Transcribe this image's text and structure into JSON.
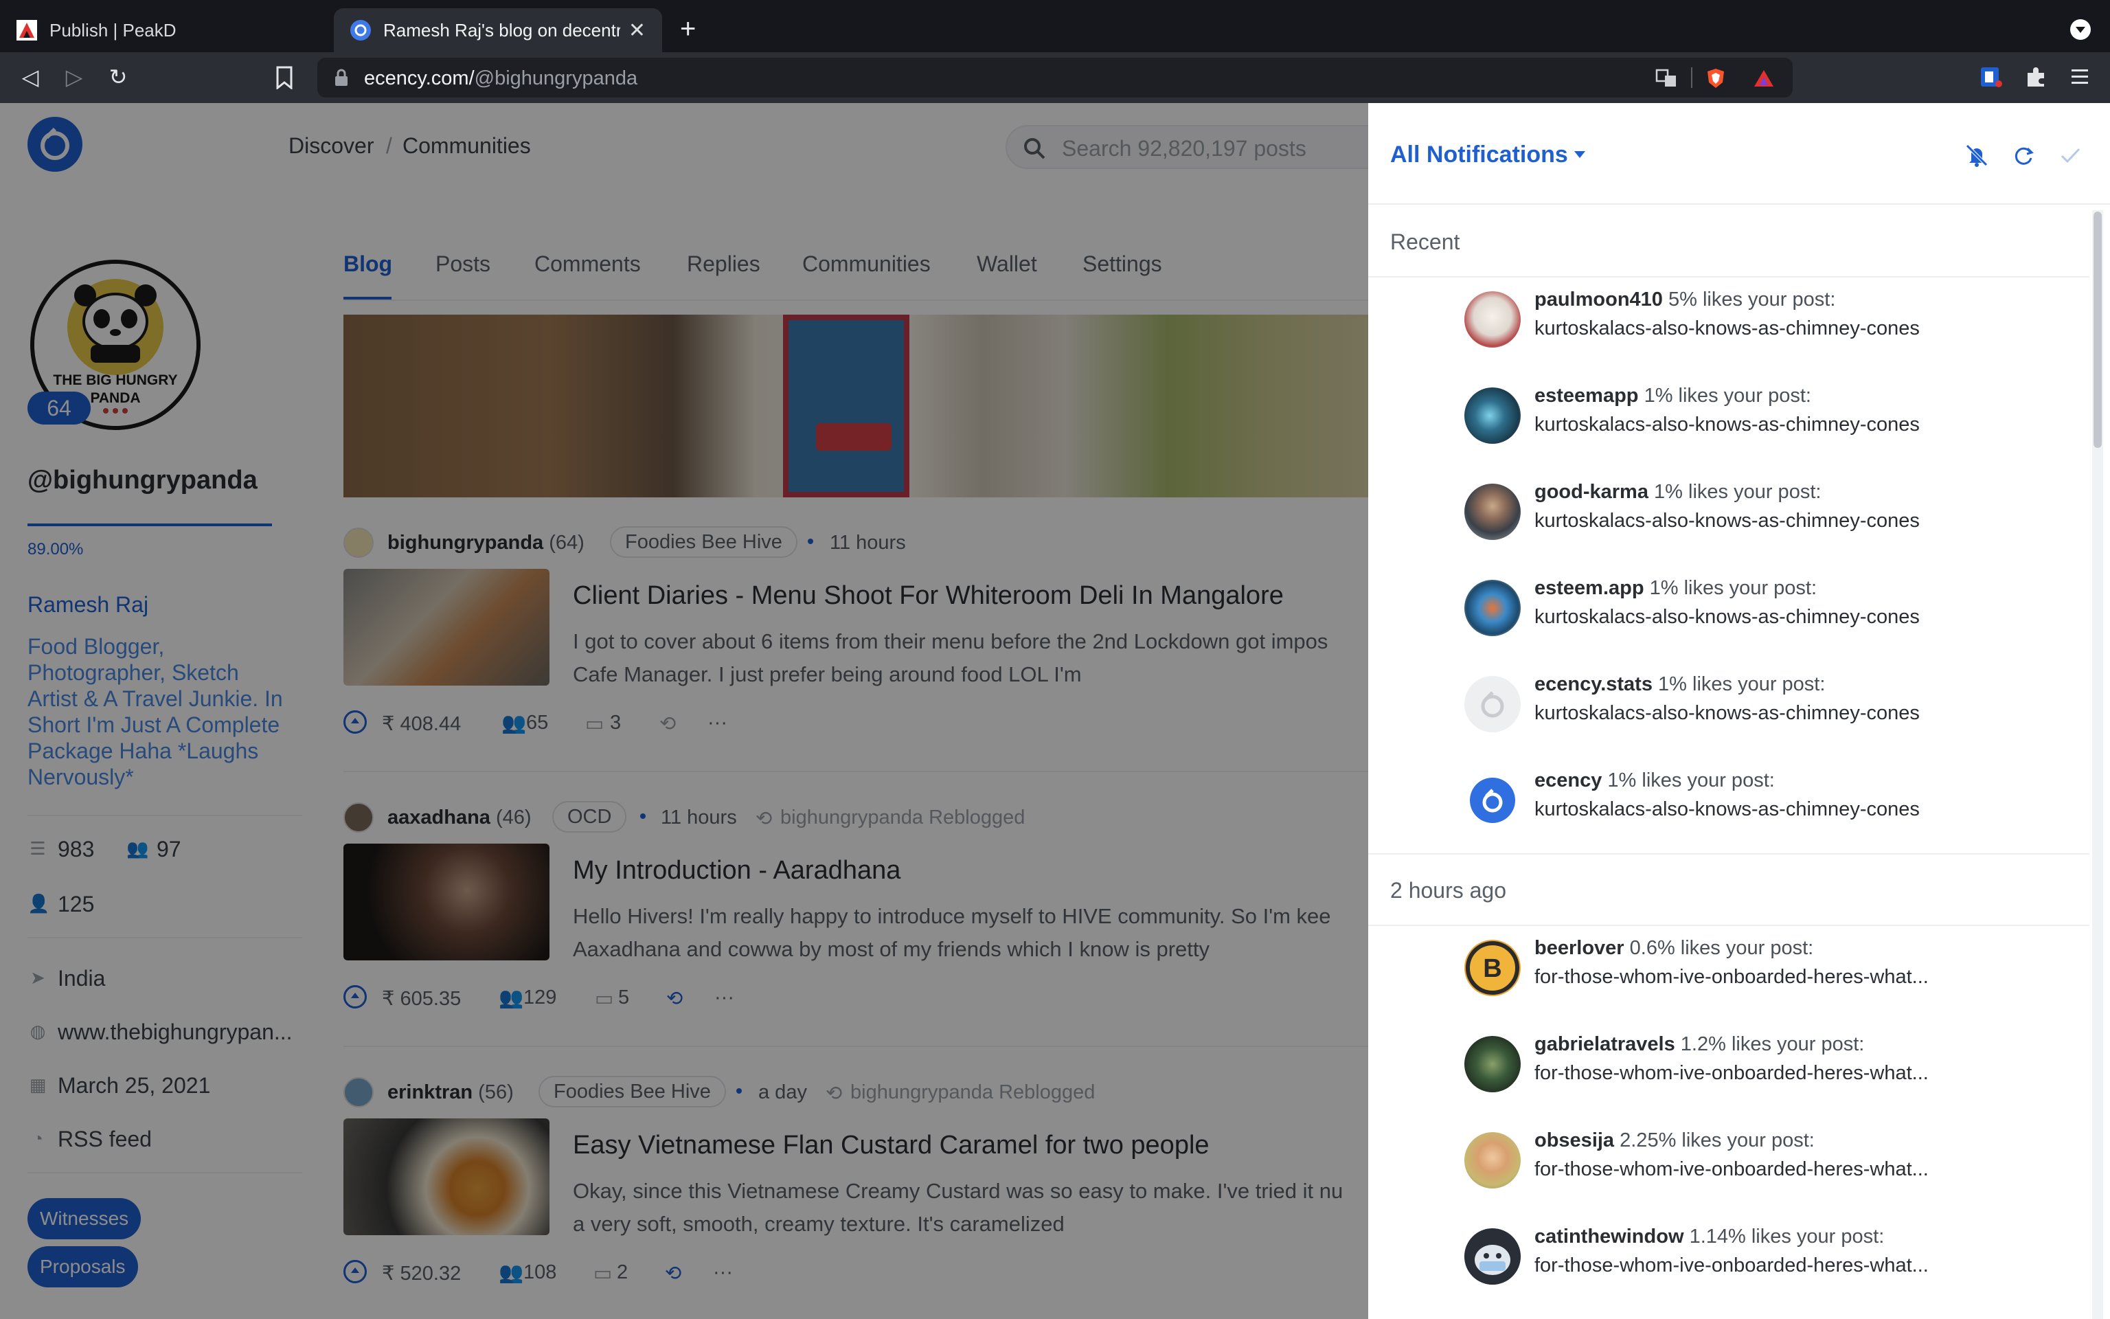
{
  "browser": {
    "tabs": [
      {
        "title": "Publish | PeakD",
        "active": false
      },
      {
        "title": "Ramesh Raj's blog on decentral",
        "active": true
      }
    ],
    "url_host": "ecency.com/",
    "url_path": "@bighungrypanda"
  },
  "header": {
    "crumbs": [
      "Discover",
      "/",
      "Communities"
    ],
    "search_placeholder": "Search 92,820,197 posts"
  },
  "profile": {
    "avatar_text_1": "THE BIG HUNGRY",
    "avatar_text_2": "PANDA",
    "reputation": "64",
    "username": "@bighungrypanda",
    "voting_power": "89.00%",
    "full_name": "Ramesh Raj",
    "bio_lines": [
      "Food Blogger,",
      "Photographer, Sketch",
      "Artist & A Travel Junkie. In",
      "Short I'm Just A Complete",
      "Package Haha *Laughs",
      "Nervously*"
    ],
    "posts_count": "983",
    "followers": "97",
    "following": "125",
    "location": "India",
    "website": "www.thebighungrypan...",
    "joined": "March 25, 2021",
    "rss": "RSS feed",
    "buttons": [
      "Witnesses",
      "Proposals"
    ]
  },
  "tabs": [
    "Blog",
    "Posts",
    "Comments",
    "Replies",
    "Communities",
    "Wallet",
    "Settings"
  ],
  "posts": [
    {
      "author": "bighungrypanda",
      "rep": "(64)",
      "community": "Foodies Bee Hive",
      "time": "11 hours",
      "reblog": "",
      "title": "Client Diaries - Menu Shoot For Whiteroom Deli In Mangalore",
      "body1": "I got to cover about 6 items from their menu before the 2nd Lockdown got impos",
      "body2": "Cafe Manager. I just prefer being around food LOL I'm",
      "payout": "₹ 408.44",
      "votes": "65",
      "comments": "3"
    },
    {
      "author": "aaxadhana",
      "rep": "(46)",
      "community": "OCD",
      "time": "11 hours",
      "reblog": "bighungrypanda Reblogged",
      "title": "My Introduction - Aaradhana",
      "body1": "Hello Hivers! I'm really happy to introduce myself to HIVE community. So I'm kee",
      "body2": "Aaxadhana and cowwa by most of my friends which I know is pretty",
      "payout": "₹ 605.35",
      "votes": "129",
      "comments": "5"
    },
    {
      "author": "erinktran",
      "rep": "(56)",
      "community": "Foodies Bee Hive",
      "time": "a day",
      "reblog": "bighungrypanda Reblogged",
      "title": "Easy Vietnamese Flan Custard Caramel for two people",
      "body1": "Okay, since this Vietnamese Creamy Custard was so easy to make. I've tried it nu",
      "body2": "a very soft, smooth, creamy texture. It's caramelized",
      "payout": "₹ 520.32",
      "votes": "108",
      "comments": "2"
    }
  ],
  "notifications": {
    "filter": "All Notifications",
    "sections": [
      {
        "label": "Recent",
        "items": [
          {
            "user": "paulmoon410",
            "text": "5% likes your post:",
            "post": "kurtoskalacs-also-knows-as-chimney-cones"
          },
          {
            "user": "esteemapp",
            "text": "1% likes your post:",
            "post": "kurtoskalacs-also-knows-as-chimney-cones"
          },
          {
            "user": "good-karma",
            "text": "1% likes your post:",
            "post": "kurtoskalacs-also-knows-as-chimney-cones"
          },
          {
            "user": "esteem.app",
            "text": "1% likes your post:",
            "post": "kurtoskalacs-also-knows-as-chimney-cones"
          },
          {
            "user": "ecency.stats",
            "text": "1% likes your post:",
            "post": "kurtoskalacs-also-knows-as-chimney-cones"
          },
          {
            "user": "ecency",
            "text": "1% likes your post:",
            "post": "kurtoskalacs-also-knows-as-chimney-cones"
          }
        ]
      },
      {
        "label": "2 hours ago",
        "items": [
          {
            "user": "beerlover",
            "text": "0.6% likes your post:",
            "post": "for-those-whom-ive-onboarded-heres-what..."
          },
          {
            "user": "gabrielatravels",
            "text": "1.2% likes your post:",
            "post": "for-those-whom-ive-onboarded-heres-what..."
          },
          {
            "user": "obsesija",
            "text": "2.25% likes your post:",
            "post": "for-those-whom-ive-onboarded-heres-what..."
          },
          {
            "user": "catinthewindow",
            "text": "1.14% likes your post:",
            "post": "for-those-whom-ive-onboarded-heres-what..."
          }
        ]
      }
    ]
  },
  "colors": {
    "accent": "#1f5fcf",
    "chrome": "#2b2e34"
  }
}
